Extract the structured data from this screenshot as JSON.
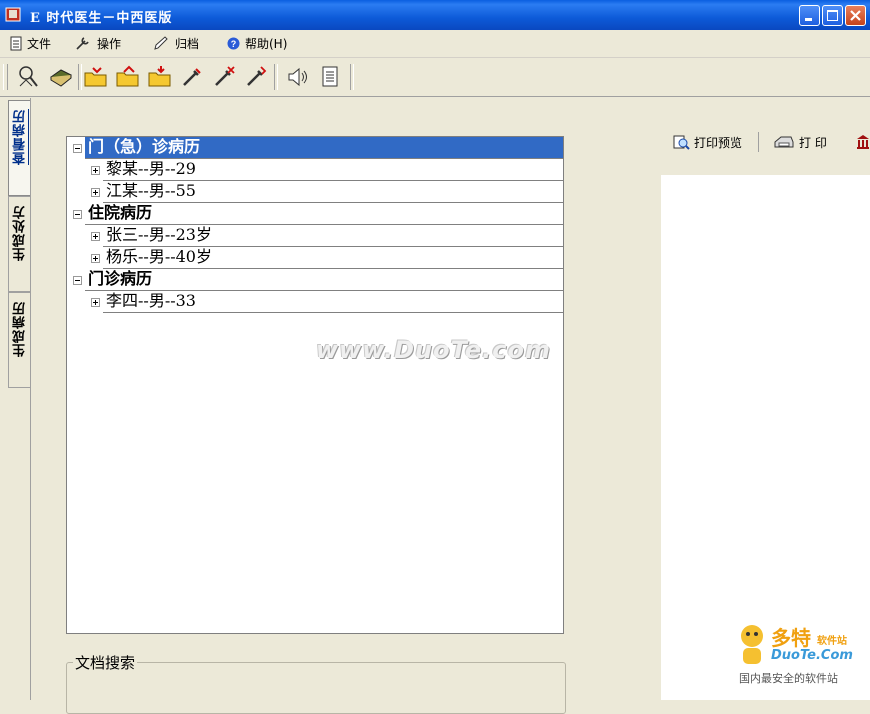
{
  "window": {
    "title": "E 时代医生－中西医版"
  },
  "menu": {
    "items": [
      {
        "label": "文件",
        "icon": "document-icon"
      },
      {
        "label": "操作",
        "icon": "wrench-icon"
      },
      {
        "label": "归档",
        "icon": "pencil-icon"
      },
      {
        "label": "帮助(H)",
        "icon": "help-icon"
      }
    ]
  },
  "toolbar": {
    "buttons": [
      "search-person-icon",
      "book-icon",
      "folder-open-icon",
      "folder-up-icon",
      "folder-down-icon",
      "syringe-icon",
      "syringe-remove-icon",
      "syringe-edit-icon",
      "speaker-icon",
      "page-icon"
    ]
  },
  "tabs": [
    {
      "label": "查看病历",
      "active": true
    },
    {
      "label": "生成处方",
      "active": false
    },
    {
      "label": "生成病历",
      "active": false
    }
  ],
  "tree": {
    "groups": [
      {
        "label": "门（急）诊病历",
        "selected": true,
        "children": [
          "黎某--男--29",
          "江某--男--55"
        ]
      },
      {
        "label": "住院病历",
        "selected": false,
        "children": [
          "张三--男--23岁",
          "杨乐--男--40岁"
        ]
      },
      {
        "label": "门诊病历",
        "selected": false,
        "children": [
          "李四--男--33"
        ]
      }
    ]
  },
  "watermark": "www.DuoTe.com",
  "search": {
    "legend": "文档搜索"
  },
  "preview_toolbar": {
    "print_preview": "打印预览",
    "print": "打 印"
  },
  "logo": {
    "name": "多特",
    "tag": "软件站",
    "domain": "DuoTe.Com",
    "slogan": "国内最安全的软件站"
  },
  "colors": {
    "titlebar": "#0a5fe0",
    "selection": "#316ac5",
    "background": "#ece9d8",
    "logo_orange": "#f0a010"
  }
}
